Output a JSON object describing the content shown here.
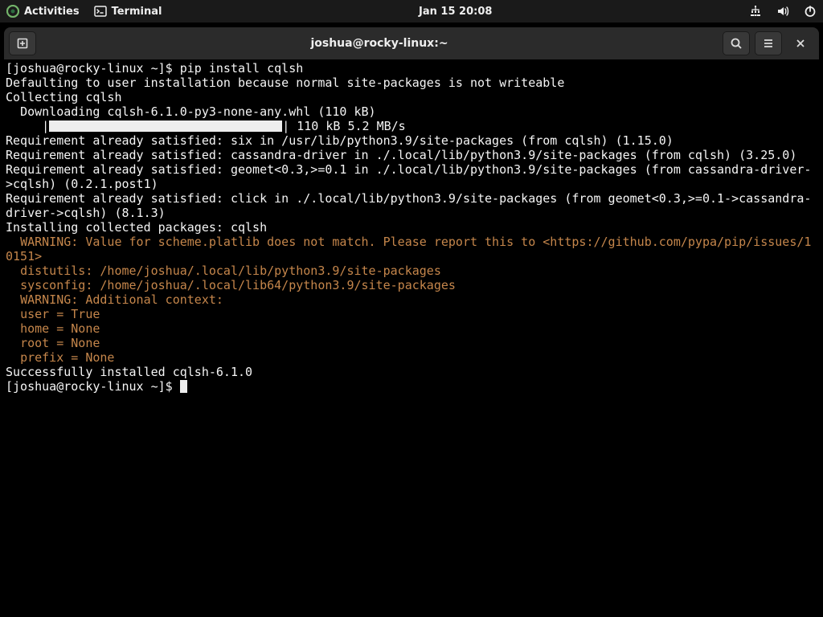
{
  "topbar": {
    "activities": "Activities",
    "app_label": "Terminal",
    "clock": "Jan 15  20:08"
  },
  "window": {
    "title": "joshua@rocky-linux:~"
  },
  "term": {
    "prompt1": "[joshua@rocky-linux ~]$ ",
    "cmd1": "pip install cqlsh",
    "l2": "Defaulting to user installation because normal site-packages is not writeable",
    "l3": "Collecting cqlsh",
    "l4": "  Downloading cqlsh-6.1.0-py3-none-any.whl (110 kB)",
    "l5pre": "     |",
    "l5post": "| 110 kB 5.2 MB/s",
    "l6": "Requirement already satisfied: six in /usr/lib/python3.9/site-packages (from cqlsh) (1.15.0)",
    "l7": "Requirement already satisfied: cassandra-driver in ./.local/lib/python3.9/site-packages (from cqlsh) (3.25.0)",
    "l8": "Requirement already satisfied: geomet<0.3,>=0.1 in ./.local/lib/python3.9/site-packages (from cassandra-driver->cqlsh) (0.2.1.post1)",
    "l9": "Requirement already satisfied: click in ./.local/lib/python3.9/site-packages (from geomet<0.3,>=0.1->cassandra-driver->cqlsh) (8.1.3)",
    "l10": "Installing collected packages: cqlsh",
    "w1": "  WARNING: Value for scheme.platlib does not match. Please report this to <https://github.com/pypa/pip/issues/10151>",
    "w2": "  distutils: /home/joshua/.local/lib/python3.9/site-packages",
    "w3": "  sysconfig: /home/joshua/.local/lib64/python3.9/site-packages",
    "w4": "  WARNING: Additional context:",
    "w5": "  user = True",
    "w6": "  home = None",
    "w7": "  root = None",
    "w8": "  prefix = None",
    "l11": "Successfully installed cqlsh-6.1.0",
    "prompt2": "[joshua@rocky-linux ~]$ "
  }
}
